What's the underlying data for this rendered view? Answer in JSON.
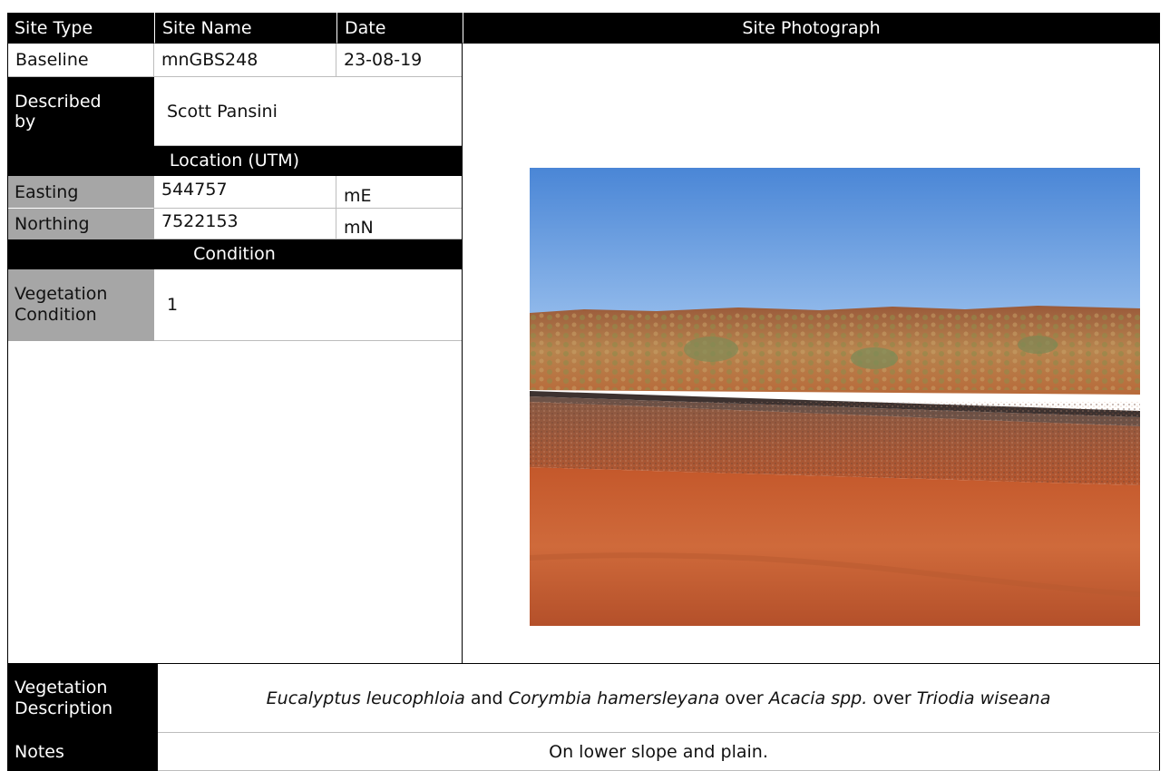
{
  "headers": {
    "site_type": "Site Type",
    "site_name": "Site Name",
    "date": "Date",
    "site_photograph": "Site Photograph"
  },
  "site": {
    "type": "Baseline",
    "name": "mnGBS248",
    "date": "23-08-19"
  },
  "described_by": {
    "label_line1": "Described",
    "label_line2": "by",
    "value": "Scott Pansini"
  },
  "location": {
    "section_title": "Location (UTM)",
    "easting_label": "Easting",
    "easting_value": "544757",
    "easting_unit": "mE",
    "northing_label": "Northing",
    "northing_value": "7522153",
    "northing_unit": "mN"
  },
  "condition": {
    "section_title": "Condition",
    "label_line1": "Vegetation",
    "label_line2": "Condition",
    "value": "1"
  },
  "vegetation_description": {
    "label_line1": "Vegetation",
    "label_line2": "Description",
    "species1": "Eucalyptus leucophloia",
    "and": " and ",
    "species2": "Corymbia hamersleyana",
    "over1": " over ",
    "species3": "Acacia spp.",
    "over2": " over ",
    "species4": "Triodia wiseana"
  },
  "notes": {
    "label": "Notes",
    "value": "On lower slope and plain."
  }
}
